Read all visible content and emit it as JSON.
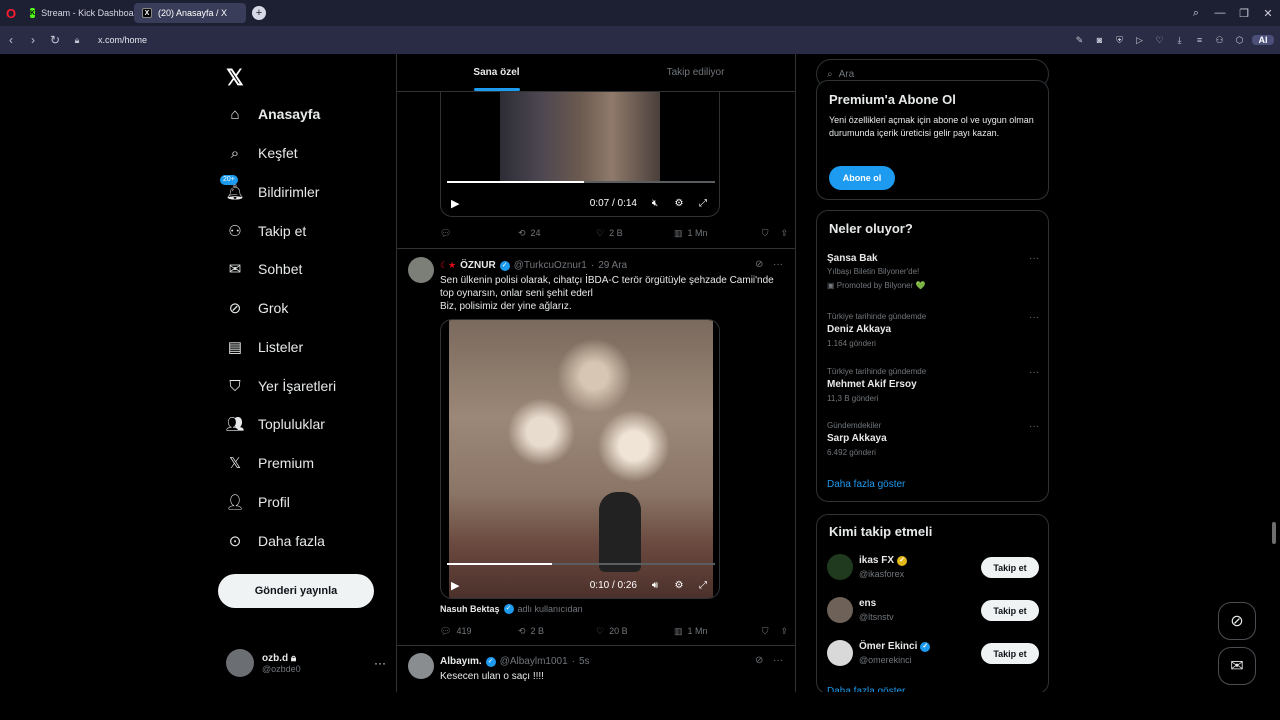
{
  "browser": {
    "tabs": [
      {
        "label": "Stream - Kick Dashboard",
        "active": false,
        "favicon_color": "#53fc18",
        "favicon_text": "K"
      },
      {
        "label": "(20) Anasayfa / X",
        "active": true,
        "favicon_color": "#000000",
        "favicon_text": "X"
      }
    ],
    "url": "x.com/home",
    "ai_label": "AI"
  },
  "nav": {
    "items": [
      {
        "label": "Anasayfa",
        "icon": "home-icon"
      },
      {
        "label": "Keşfet",
        "icon": "search-icon"
      },
      {
        "label": "Bildirimler",
        "icon": "bell-icon",
        "badge": "20+"
      },
      {
        "label": "Takip et",
        "icon": "add-person-icon"
      },
      {
        "label": "Sohbet",
        "icon": "mail-icon"
      },
      {
        "label": "Grok",
        "icon": "grok-icon"
      },
      {
        "label": "Listeler",
        "icon": "list-icon"
      },
      {
        "label": "Yer İşaretleri",
        "icon": "bookmark-icon"
      },
      {
        "label": "Topluluklar",
        "icon": "communities-icon"
      },
      {
        "label": "Premium",
        "icon": "x-premium-icon"
      },
      {
        "label": "Profil",
        "icon": "person-icon"
      },
      {
        "label": "Daha fazla",
        "icon": "more-circle-icon"
      }
    ],
    "post_button": "Gönderi yayınla",
    "account": {
      "name": "ozb.d",
      "handle": "@ozbde0"
    }
  },
  "timeline": {
    "tabs": [
      {
        "label": "Sana özel",
        "active": true
      },
      {
        "label": "Takip ediliyor",
        "active": false
      }
    ],
    "post1": {
      "video_time": "0:07 / 0:14",
      "progress": 0.51,
      "actions": {
        "reply": "",
        "retweet": "24",
        "like": "2 B",
        "views": "1 Mn"
      }
    },
    "post2": {
      "name": "ÖZNUR",
      "handle": "@TurkcuOznur1",
      "time": "29 Ara",
      "text": [
        "Sen ülkenin polisi olarak, cihatçı İBDA-C terör örgütüyle şehzade Camii'nde",
        "top oynarsın, onlar seni şehit ederl",
        "Biz, polisimiz der yine  ağlarız."
      ],
      "video_time": "0:10 / 0:26",
      "progress": 0.39,
      "caption_name": "Nasuh Bektaş",
      "caption_text": "adlı kullanıcıdan",
      "actions": {
        "reply": "419",
        "retweet": "2 B",
        "like": "20 B",
        "views": "1 Mn"
      }
    },
    "post3": {
      "name": "Albayım.",
      "handle": "@Albaylm1001",
      "time": "5s",
      "text": "Kesecen ulan o saçı  !!!!"
    }
  },
  "right": {
    "search_placeholder": "Ara",
    "premium": {
      "title": "Premium'a Abone Ol",
      "desc": "Yeni özellikleri açmak için abone ol ve uygun olman durumunda içerik üreticisi gelir payı kazan.",
      "button": "Abone ol"
    },
    "trends": {
      "title": "Neler oluyor?",
      "items": [
        {
          "small": "",
          "main": "Şansa Bak",
          "sub": "Yılbaşı Biletin Bilyoner'de!",
          "promo": "Promoted by Bilyoner 💚"
        },
        {
          "small": "Türkiye tarihinde gündemde",
          "main": "Deniz Akkaya",
          "sub": "1.164 gönderi"
        },
        {
          "small": "Türkiye tarihinde gündemde",
          "main": "Mehmet Akif Ersoy",
          "sub": "11,3 B gönderi"
        },
        {
          "small": "Gündemdekiler",
          "main": "Sarp Akkaya",
          "sub": "6.492 gönderi"
        }
      ],
      "show_more": "Daha fazla göster"
    },
    "who_to_follow": {
      "title": "Kimi takip etmeli",
      "items": [
        {
          "name": "ikas FX",
          "handle": "@ikasforex",
          "button": "Takip et"
        },
        {
          "name": "ens",
          "handle": "@ltsnstv",
          "button": "Takip et"
        },
        {
          "name": "Ömer Ekinci",
          "handle": "@omerekinci",
          "button": "Takip et"
        }
      ],
      "show_more": "Daha fazla göster"
    }
  },
  "colors": {
    "accent": "#1d9bf0",
    "background": "#000000",
    "border": "#2f3336"
  }
}
